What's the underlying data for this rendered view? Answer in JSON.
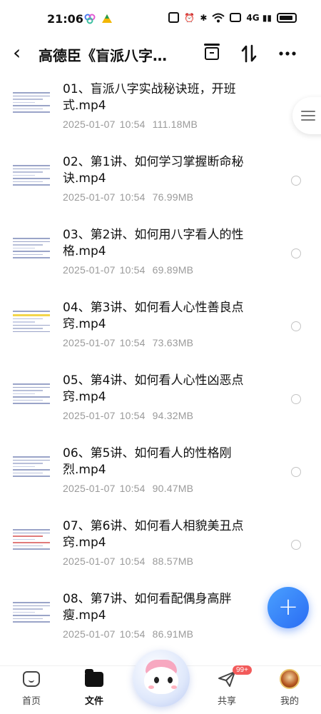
{
  "status_bar": {
    "time": "21:06",
    "network_label": "4G"
  },
  "header": {
    "title": "高德臣《盲派八字…"
  },
  "files": [
    {
      "name": "01、盲派八字实战秘诀班，开班式.mp4",
      "date": "2025-01-07",
      "time": "10:54",
      "size": "111.18MB"
    },
    {
      "name": "02、第1讲、如何学习掌握断命秘诀.mp4",
      "date": "2025-01-07",
      "time": "10:54",
      "size": "76.99MB"
    },
    {
      "name": "03、第2讲、如何用八字看人的性格.mp4",
      "date": "2025-01-07",
      "time": "10:54",
      "size": "69.89MB"
    },
    {
      "name": "04、第3讲、如何看人心性善良点窍.mp4",
      "date": "2025-01-07",
      "time": "10:54",
      "size": "73.63MB"
    },
    {
      "name": "05、第4讲、如何看人心性凶恶点窍.mp4",
      "date": "2025-01-07",
      "time": "10:54",
      "size": "94.32MB"
    },
    {
      "name": "06、第5讲、如何看人的性格刚烈.mp4",
      "date": "2025-01-07",
      "time": "10:54",
      "size": "90.47MB"
    },
    {
      "name": "07、第6讲、如何看人相貌美丑点窍.mp4",
      "date": "2025-01-07",
      "time": "10:54",
      "size": "88.57MB"
    },
    {
      "name": "08、第7讲、如何看配偶身高胖瘦.mp4",
      "date": "2025-01-07",
      "time": "10:54",
      "size": "86.91MB"
    }
  ],
  "fab": {
    "symbol": "+"
  },
  "nav": {
    "home": "首页",
    "files": "文件",
    "share": "共享",
    "mine": "我的",
    "share_badge": "99+"
  },
  "colors": {
    "accent": "#2a6cf3",
    "meta_text": "#9a9a9a",
    "badge": "#f25a5a"
  },
  "icons": [
    "back-arrow-icon",
    "folder-icon",
    "sort-icon",
    "more-icon",
    "menu-lines-icon",
    "plus-icon",
    "home-icon",
    "file-icon",
    "share-icon",
    "avatar-icon"
  ]
}
